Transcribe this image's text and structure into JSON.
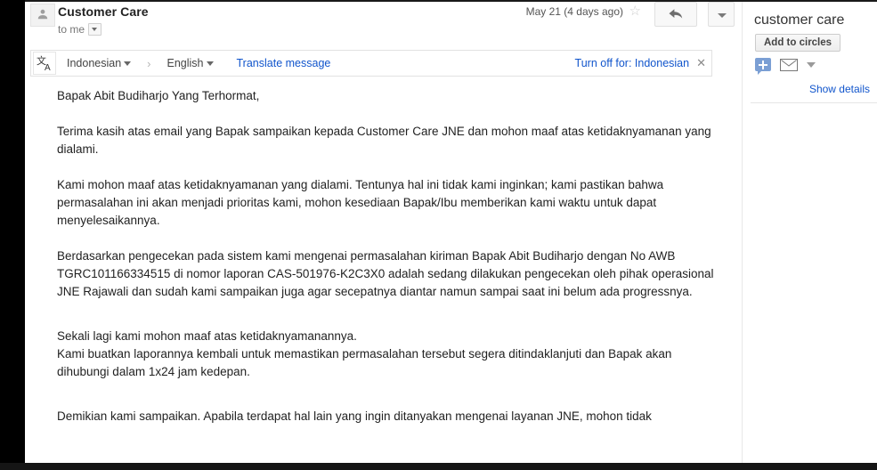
{
  "message": {
    "avatar_icon": "person-avatar-icon",
    "sender": "Customer Care",
    "recipient_line": "to me",
    "date": "May 21 (4 days ago)",
    "star_icon": "☆",
    "reply_icon": "reply-arrow-icon",
    "more_icon": "chevron-down-icon"
  },
  "translate_bar": {
    "icon": "translate-icon",
    "source_language": "Indonesian",
    "arrow": "›",
    "target_language": "English",
    "translate_link": "Translate message",
    "turn_off_link": "Turn off for: Indonesian",
    "close_icon": "✕"
  },
  "body": {
    "paragraphs": [
      "Bapak Abit Budiharjo Yang Terhormat,",
      "Terima kasih atas email yang Bapak sampaikan kepada Customer Care JNE dan mohon maaf atas ketidaknyamanan yang dialami.",
      "Kami  mohon maaf  atas ketidaknyamanan yang dialami. Tentunya hal ini tidak kami inginkan; kami pastikan bahwa permasalahan ini akan menjadi prioritas kami, mohon kesediaan Bapak/Ibu memberikan kami waktu untuk dapat menyelesaikannya.",
      "Berdasarkan pengecekan pada sistem kami mengenai permasalahan kiriman Bapak Abit Budiharjo dengan No AWB TGRC101166334515 di nomor laporan CAS-501976-K2C3X0 adalah sedang dilakukan pengecekan oleh pihak operasional JNE Rajawali dan sudah kami sampaikan juga agar secepatnya diantar namun sampai saat ini belum ada progressnya.",
      "Sekali lagi kami mohon maaf atas ketidaknyamanannya.",
      "Kami buatkan laporannya kembali untuk memastikan permasalahan tersebut segera ditindaklanjuti dan Bapak akan dihubungi dalam 1x24 jam kedepan.",
      "Demikian kami sampaikan. Apabila terdapat hal lain yang ingin ditanyakan mengenai layanan JNE, mohon tidak"
    ]
  },
  "sidebar": {
    "contact_name": "customer care",
    "add_to_circles_label": "Add to circles",
    "chat_icon": "chat-plus-icon",
    "email_icon": "envelope-icon",
    "more_icon": "chevron-down-icon",
    "show_details_label": "Show details"
  },
  "colors": {
    "link": "#1155cc",
    "text": "#222222",
    "muted": "#777777",
    "chat_icon_blue": "#7b9fd4",
    "frame_black": "#000000"
  }
}
